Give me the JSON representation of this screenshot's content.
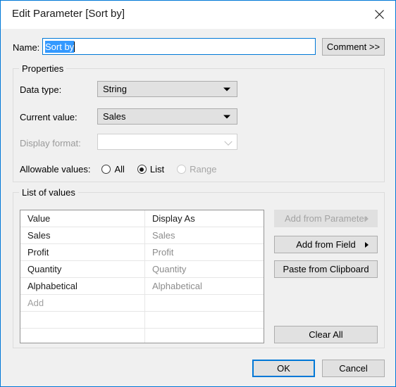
{
  "window": {
    "title": "Edit Parameter [Sort by]",
    "close_icon": "close-icon",
    "accent_color": "#0078d7"
  },
  "name_row": {
    "label": "Name:",
    "value": "Sort by",
    "selected": true,
    "comment_button": "Comment >>"
  },
  "properties": {
    "group_label": "Properties",
    "data_type": {
      "label": "Data type:",
      "value": "String",
      "enabled": true
    },
    "current_value": {
      "label": "Current value:",
      "value": "Sales",
      "enabled": true
    },
    "display_format": {
      "label": "Display format:",
      "value": "",
      "enabled": false
    },
    "allowable_values": {
      "label": "Allowable values:",
      "options": [
        {
          "label": "All",
          "selected": false,
          "enabled": true
        },
        {
          "label": "List",
          "selected": true,
          "enabled": true
        },
        {
          "label": "Range",
          "selected": false,
          "enabled": false
        }
      ]
    }
  },
  "list_of_values": {
    "group_label": "List of values",
    "columns": [
      "Value",
      "Display As"
    ],
    "rows": [
      {
        "value": "Sales",
        "display_as": "Sales"
      },
      {
        "value": "Profit",
        "display_as": "Profit"
      },
      {
        "value": "Quantity",
        "display_as": "Quantity"
      },
      {
        "value": "Alphabetical",
        "display_as": "Alphabetical"
      }
    ],
    "add_placeholder": "Add",
    "empty_rows": 2,
    "buttons": [
      {
        "label": "Add from Parameter",
        "enabled": false,
        "submenu": true
      },
      {
        "label": "Add from Field",
        "enabled": true,
        "submenu": true
      },
      {
        "label": "Paste from Clipboard",
        "enabled": true,
        "submenu": false
      },
      {
        "label": "Clear All",
        "enabled": true,
        "submenu": false
      }
    ]
  },
  "footer": {
    "ok": "OK",
    "cancel": "Cancel"
  }
}
